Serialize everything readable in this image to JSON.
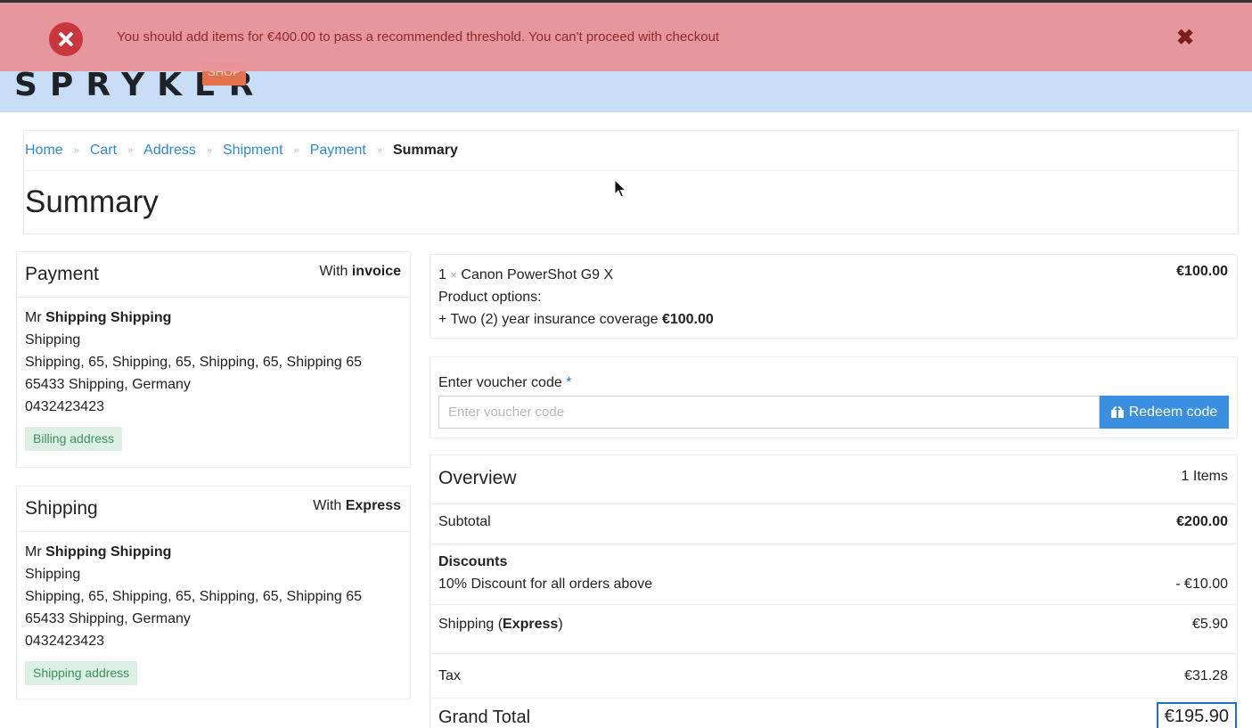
{
  "header": {
    "logo": "SPRYKER",
    "logo_tag": "SHOP"
  },
  "alert": {
    "message": "You should add items for €400.00 to pass a recommended threshold. You can't proceed with checkout",
    "close": "✖"
  },
  "breadcrumb": {
    "sep": "»",
    "items": [
      "Home",
      "Cart",
      "Address",
      "Shipment",
      "Payment"
    ],
    "current": "Summary"
  },
  "page_title": "Summary",
  "payment": {
    "title": "Payment",
    "method_prefix": "With",
    "method": "invoice",
    "salutation": "Mr",
    "name": "Shipping Shipping",
    "line1": "Shipping",
    "line2": "Shipping, 65, Shipping, 65, Shipping, 65, Shipping 65",
    "line3": "65433 Shipping, Germany",
    "phone": "0432423423",
    "tag": "Billing address"
  },
  "shipping": {
    "title": "Shipping",
    "method_prefix": "With",
    "method": "Express",
    "salutation": "Mr",
    "name": "Shipping Shipping",
    "line1": "Shipping",
    "line2": "Shipping, 65, Shipping, 65, Shipping, 65, Shipping 65",
    "line3": "65433 Shipping, Germany",
    "phone": "0432423423",
    "tag": "Shipping address"
  },
  "cart_item": {
    "qty": "1",
    "times": "×",
    "name": "Canon PowerShot G9 X",
    "price": "€100.00",
    "options_label": "Product options:",
    "option_text": "+ Two (2) year insurance coverage",
    "option_price": "€100.00"
  },
  "voucher": {
    "label": "Enter voucher code",
    "required_mark": "*",
    "placeholder": "Enter voucher code",
    "button": "Redeem code"
  },
  "overview": {
    "title": "Overview",
    "items_count": "1 Items",
    "subtotal_label": "Subtotal",
    "subtotal_value": "€200.00",
    "discounts_label": "Discounts",
    "discount_name": "10% Discount for all orders above",
    "discount_value": "- €10.00",
    "shipping_label": "Shipping (",
    "shipping_method": "Express",
    "shipping_close": ")",
    "shipping_value": "€5.90",
    "tax_label": "Tax",
    "tax_value": "€31.28",
    "grand_total_label": "Grand Total",
    "grand_total_value": "€195.90"
  },
  "colors": {
    "alert_bg": "#e8949b",
    "link": "#2d89d3",
    "button": "#3a8fe0",
    "header_bg": "#c8def6"
  }
}
